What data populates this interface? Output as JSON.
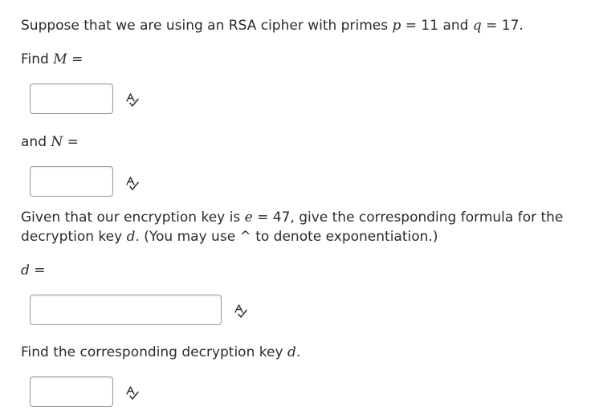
{
  "question": {
    "intro_prefix": "Suppose that we are using an RSA cipher with primes",
    "p_var": "p",
    "p_eq": " = 11 and",
    "q_var": "q",
    "q_eq": " = 17."
  },
  "find_m": {
    "prefix": "Find",
    "var": "M",
    "suffix": " ="
  },
  "and_n": {
    "prefix": "and",
    "var": "N",
    "suffix": " ="
  },
  "given": {
    "line1_prefix": "Given that our encryption key is",
    "e_var": "e",
    "line1_suffix": " = 47, give the corresponding formula for the",
    "line2_prefix": "decryption key",
    "d_var": "d",
    "line2_suffix": ". (You may use  ^ to denote exponentiation.)"
  },
  "d_label": {
    "var": "d",
    "suffix": " ="
  },
  "find_d": {
    "prefix": "Find the corresponding decryption key",
    "var": "d",
    "suffix": "."
  },
  "inputs": {
    "m_value": "",
    "n_value": "",
    "d_formula_value": "",
    "d_value": ""
  },
  "icons": {
    "spellcheck": "spellcheck-icon"
  }
}
